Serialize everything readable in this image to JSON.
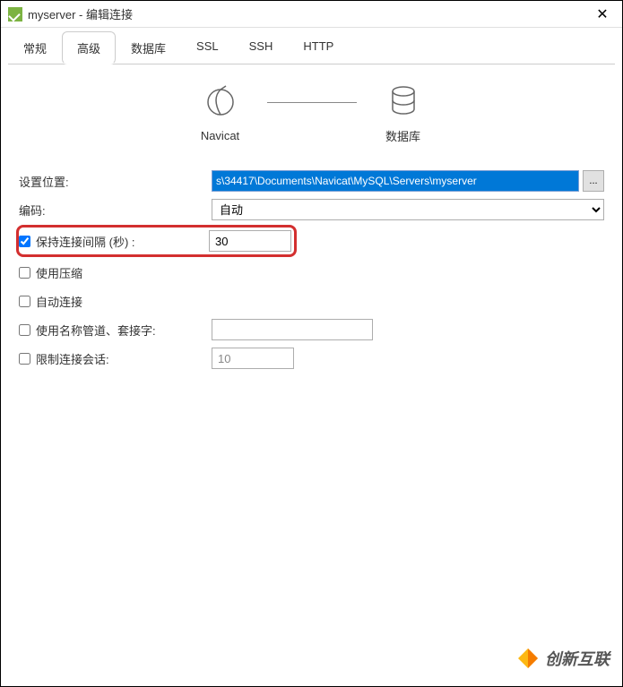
{
  "titlebar": {
    "title": "myserver - 编辑连接"
  },
  "tabs": [
    {
      "label": "常规"
    },
    {
      "label": "高级",
      "active": true
    },
    {
      "label": "数据库"
    },
    {
      "label": "SSL"
    },
    {
      "label": "SSH"
    },
    {
      "label": "HTTP"
    }
  ],
  "diagram": {
    "left_label": "Navicat",
    "right_label": "数据库"
  },
  "form": {
    "location_label": "设置位置:",
    "location_value": "s\\34417\\Documents\\Navicat\\MySQL\\Servers\\myserver",
    "browse_label": "...",
    "encoding_label": "编码:",
    "encoding_value": "自动",
    "keepalive_label": "保持连接间隔 (秒) :",
    "keepalive_value": "30",
    "keepalive_checked": true,
    "compress_label": "使用压缩",
    "compress_checked": false,
    "autoconnect_label": "自动连接",
    "autoconnect_checked": false,
    "namedpipe_label": "使用名称管道、套接字:",
    "namedpipe_checked": false,
    "namedpipe_value": "",
    "limitconn_label": "限制连接会话:",
    "limitconn_checked": false,
    "limitconn_value": "10"
  },
  "watermark": {
    "text": "创新互联"
  }
}
